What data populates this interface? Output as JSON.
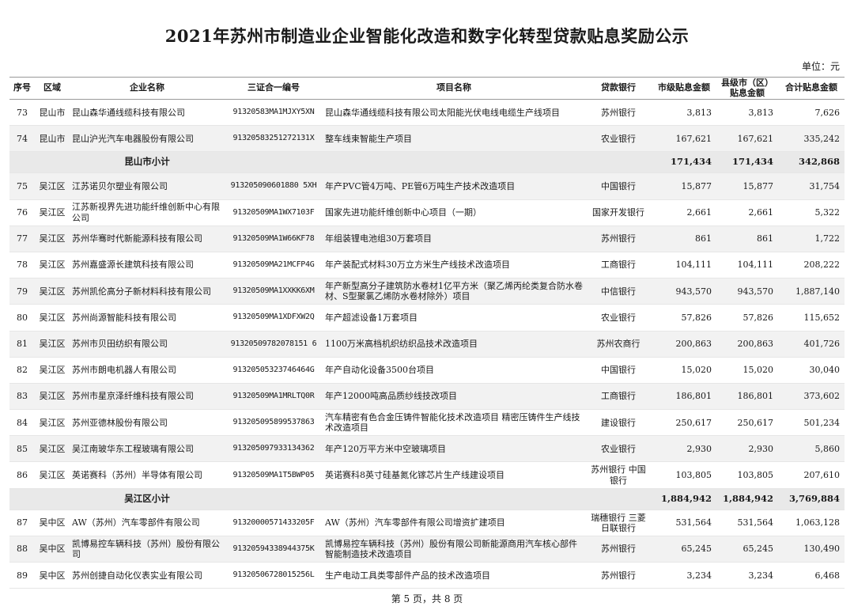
{
  "title": "2021年苏州市制造业企业智能化改造和数字化转型贷款贴息奖励公示",
  "unit": "单位：元",
  "columns": {
    "no": "序号",
    "region": "区域",
    "company": "企业名称",
    "code": "三证合一编号",
    "project": "项目名称",
    "bank": "贷款银行",
    "city": "市级贴息金额",
    "county": "县级市（区）贴息金额",
    "total": "合计贴息金额"
  },
  "rows": [
    {
      "type": "row",
      "no": "73",
      "region": "昆山市",
      "company": "昆山森华通线缆科技有限公司",
      "code": "91320583MA1MJXY5XN",
      "project": "昆山森华通线缆科技有限公司太阳能光伏电线电缆生产线项目",
      "bank": "苏州银行",
      "city": "3,813",
      "county": "3,813",
      "total": "7,626"
    },
    {
      "type": "row",
      "no": "74",
      "region": "昆山市",
      "company": "昆山沪光汽车电器股份有限公司",
      "code": "91320583251272131X",
      "project": "整车线束智能生产项目",
      "bank": "农业银行",
      "city": "167,621",
      "county": "167,621",
      "total": "335,242"
    },
    {
      "type": "subtotal",
      "label": "昆山市小计",
      "city": "171,434",
      "county": "171,434",
      "total": "342,868"
    },
    {
      "type": "row",
      "no": "75",
      "region": "吴江区",
      "company": "江苏诺贝尔塑业有限公司",
      "code": "913205090601880 5XH",
      "project": "年产PVC管4万吨、PE管6万吨生产技术改造项目",
      "bank": "中国银行",
      "city": "15,877",
      "county": "15,877",
      "total": "31,754"
    },
    {
      "type": "row",
      "no": "76",
      "region": "吴江区",
      "company": "江苏新视界先进功能纤维创新中心有限公司",
      "code": "91320509MA1WX7103F",
      "project": "国家先进功能纤维创新中心项目（一期）",
      "bank": "国家开发银行",
      "city": "2,661",
      "county": "2,661",
      "total": "5,322"
    },
    {
      "type": "row",
      "no": "77",
      "region": "吴江区",
      "company": "苏州华骞时代新能源科技有限公司",
      "code": "91320509MA1W66KF78",
      "project": "年组装锂电池组30万套项目",
      "bank": "苏州银行",
      "city": "861",
      "county": "861",
      "total": "1,722"
    },
    {
      "type": "row",
      "no": "78",
      "region": "吴江区",
      "company": "苏州嘉盛源长建筑科技有限公司",
      "code": "91320509MA21MCFP4G",
      "project": "年产装配式材料30万立方米生产线技术改造项目",
      "bank": "工商银行",
      "city": "104,111",
      "county": "104,111",
      "total": "208,222"
    },
    {
      "type": "row",
      "no": "79",
      "region": "吴江区",
      "company": "苏州凯伦高分子新材料科技有限公司",
      "code": "91320509MA1XXKK6XM",
      "project": "年产新型高分子建筑防水卷材1亿平方米（聚乙烯丙纶类复合防水卷材、S型聚氯乙烯防水卷材除外）项目",
      "bank": "中信银行",
      "city": "943,570",
      "county": "943,570",
      "total": "1,887,140"
    },
    {
      "type": "row",
      "no": "80",
      "region": "吴江区",
      "company": "苏州尚源智能科技有限公司",
      "code": "91320509MA1XDFXW2Q",
      "project": "年产超滤设备1万套项目",
      "bank": "农业银行",
      "city": "57,826",
      "county": "57,826",
      "total": "115,652"
    },
    {
      "type": "row",
      "no": "81",
      "region": "吴江区",
      "company": "苏州市贝田纺织有限公司",
      "code": "91320509782078151 6",
      "project": "1100万米高档机织纺织品技术改造项目",
      "bank": "苏州农商行",
      "city": "200,863",
      "county": "200,863",
      "total": "401,726"
    },
    {
      "type": "row",
      "no": "82",
      "region": "吴江区",
      "company": "苏州市朗电机器人有限公司",
      "code": "91320505323746464G",
      "project": "年产自动化设备3500台项目",
      "bank": "中国银行",
      "city": "15,020",
      "county": "15,020",
      "total": "30,040"
    },
    {
      "type": "row",
      "no": "83",
      "region": "吴江区",
      "company": "苏州市星京泽纤维科技有限公司",
      "code": "91320509MA1MRLTQ0R",
      "project": "年产12000吨高品质纱线技改项目",
      "bank": "工商银行",
      "city": "186,801",
      "county": "186,801",
      "total": "373,602"
    },
    {
      "type": "row",
      "no": "84",
      "region": "吴江区",
      "company": "苏州亚德林股份有限公司",
      "code": "913205095899537863",
      "project": "汽车精密有色合金压铸件智能化技术改造项目 精密压铸件生产线技术改造项目",
      "bank": "建设银行",
      "city": "250,617",
      "county": "250,617",
      "total": "501,234"
    },
    {
      "type": "row",
      "no": "85",
      "region": "吴江区",
      "company": "吴江南玻华东工程玻璃有限公司",
      "code": "913205097933134362",
      "project": "年产120万平方米中空玻璃项目",
      "bank": "农业银行",
      "city": "2,930",
      "county": "2,930",
      "total": "5,860"
    },
    {
      "type": "row",
      "no": "86",
      "region": "吴江区",
      "company": "英诺赛科（苏州）半导体有限公司",
      "code": "91320509MA1T5BWP05",
      "project": "英诺赛科8英寸硅基氮化镓芯片生产线建设项目",
      "bank": "苏州银行 中国银行",
      "city": "103,805",
      "county": "103,805",
      "total": "207,610"
    },
    {
      "type": "subtotal",
      "label": "吴江区小计",
      "city": "1,884,942",
      "county": "1,884,942",
      "total": "3,769,884"
    },
    {
      "type": "row",
      "no": "87",
      "region": "吴中区",
      "company": "AW（苏州）汽车零部件有限公司",
      "code": "91320000571433205F",
      "project": "AW（苏州）汽车零部件有限公司增资扩建项目",
      "bank": "瑞穗银行 三菱日联银行",
      "city": "531,564",
      "county": "531,564",
      "total": "1,063,128"
    },
    {
      "type": "row",
      "no": "88",
      "region": "吴中区",
      "company": "凯博易控车辆科技（苏州）股份有限公司",
      "code": "91320594338944375K",
      "project": "凯博易控车辆科技（苏州）股份有限公司新能源商用汽车核心部件智能制造技术改造项目",
      "bank": "苏州银行",
      "city": "65,245",
      "county": "65,245",
      "total": "130,490"
    },
    {
      "type": "row",
      "no": "89",
      "region": "吴中区",
      "company": "苏州创捷自动化仪表实业有限公司",
      "code": "91320506728015256L",
      "project": "生产电动工具类零部件产品的技术改造项目",
      "bank": "苏州银行",
      "city": "3,234",
      "county": "3,234",
      "total": "6,468"
    }
  ],
  "footer": "第 5 页，共 8 页"
}
